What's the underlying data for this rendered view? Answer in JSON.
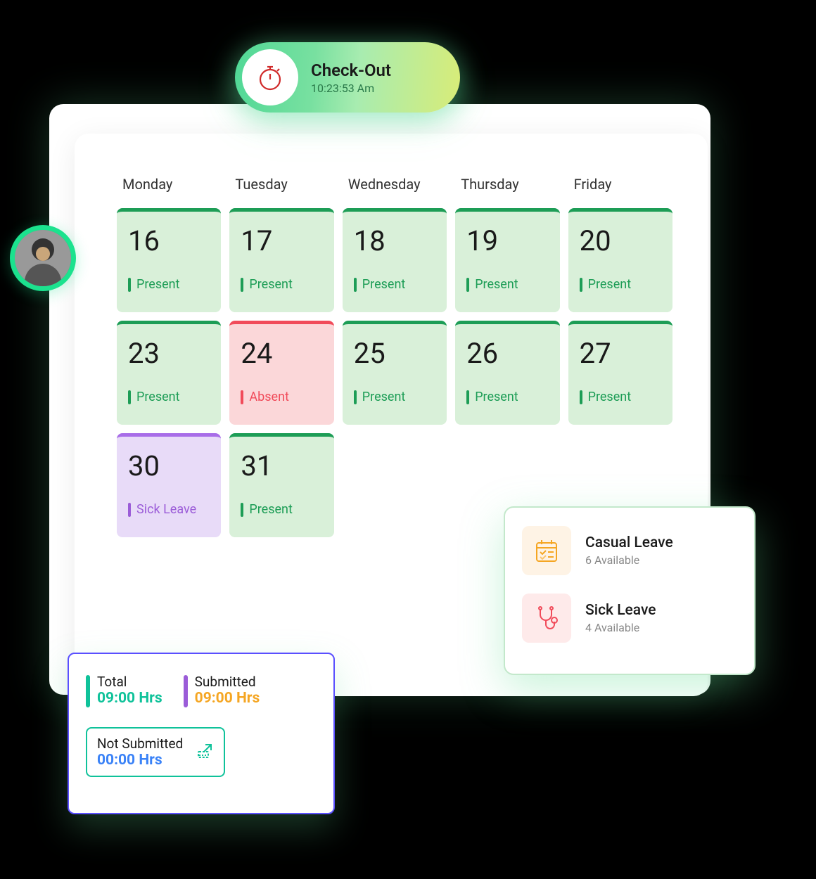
{
  "checkout": {
    "title": "Check-Out",
    "time": "10:23:53 Am"
  },
  "days": [
    "Monday",
    "Tuesday",
    "Wednesday",
    "Thursday",
    "Friday"
  ],
  "cells": [
    {
      "num": "16",
      "status": "Present",
      "type": "present"
    },
    {
      "num": "17",
      "status": "Present",
      "type": "present"
    },
    {
      "num": "18",
      "status": "Present",
      "type": "present"
    },
    {
      "num": "19",
      "status": "Present",
      "type": "present"
    },
    {
      "num": "20",
      "status": "Present",
      "type": "present"
    },
    {
      "num": "23",
      "status": "Present",
      "type": "present"
    },
    {
      "num": "24",
      "status": "Absent",
      "type": "absent"
    },
    {
      "num": "25",
      "status": "Present",
      "type": "present"
    },
    {
      "num": "26",
      "status": "Present",
      "type": "present"
    },
    {
      "num": "27",
      "status": "Present",
      "type": "present"
    },
    {
      "num": "30",
      "status": "Sick Leave",
      "type": "sick"
    },
    {
      "num": "31",
      "status": "Present",
      "type": "present"
    }
  ],
  "hours": {
    "total": {
      "label": "Total",
      "value": "09:00 Hrs"
    },
    "submitted": {
      "label": "Submitted",
      "value": "09:00 Hrs"
    },
    "not_submitted": {
      "label": "Not Submitted",
      "value": "00:00 Hrs"
    }
  },
  "leaves": {
    "casual": {
      "name": "Casual Leave",
      "avail": "6 Available"
    },
    "sick": {
      "name": "Sick Leave",
      "avail": "4 Available"
    }
  }
}
